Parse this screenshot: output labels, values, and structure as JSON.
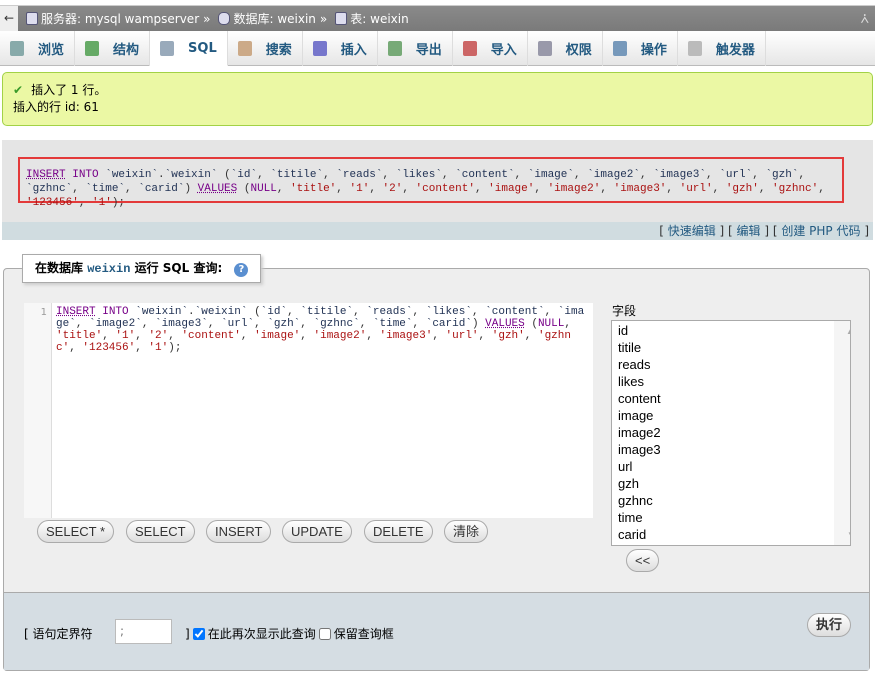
{
  "breadcrumb": {
    "back": "←",
    "server_label": "服务器: mysql wampserver",
    "database_label": "数据库: weixin",
    "table_label": "表: weixin",
    "separator": "»",
    "collapse": "⩑"
  },
  "tabs": [
    {
      "label": "浏览",
      "icon": "browse-icon",
      "color": "#8aa"
    },
    {
      "label": "结构",
      "icon": "structure-icon",
      "color": "#6a6"
    },
    {
      "label": "SQL",
      "icon": "sql-icon",
      "color": "#9ab",
      "active": true
    },
    {
      "label": "搜索",
      "icon": "search-icon",
      "color": "#ca8"
    },
    {
      "label": "插入",
      "icon": "insert-icon",
      "color": "#77c"
    },
    {
      "label": "导出",
      "icon": "export-icon",
      "color": "#7a7"
    },
    {
      "label": "导入",
      "icon": "import-icon",
      "color": "#c66"
    },
    {
      "label": "权限",
      "icon": "privileges-icon",
      "color": "#99a"
    },
    {
      "label": "操作",
      "icon": "wrench-icon",
      "color": "#79b"
    },
    {
      "label": "触发器",
      "icon": "triggers-icon",
      "color": "#bbb"
    }
  ],
  "message": {
    "line1": "插入了 1 行。",
    "line2": "插入的行 id: 61",
    "status_color": "#a2d246"
  },
  "executed_sql": "INSERT INTO `weixin`.`weixin` (`id`, `titile`, `reads`, `likes`, `content`, `image`, `image2`, `image3`, `url`, `gzh`, `gzhnc`, `time`, `carid`) VALUES (NULL, 'title', '1', '2', 'content', 'image', 'image2', 'image3', 'url', 'gzh', 'gzhnc', '123456', '1');",
  "sql_links": {
    "quick_edit": "快速编辑",
    "edit": "编辑",
    "create_php": "创建 PHP 代码"
  },
  "query_box": {
    "legend_prefix": "在数据库",
    "database": "weixin",
    "legend_suffix": "运行 SQL 查询:",
    "help": "?",
    "line_number": "1",
    "buttons": [
      "SELECT *",
      "SELECT",
      "INSERT",
      "UPDATE",
      "DELETE",
      "清除"
    ],
    "fields_label": "字段",
    "fields": [
      "id",
      "titile",
      "reads",
      "likes",
      "content",
      "image",
      "image2",
      "image3",
      "url",
      "gzh",
      "gzhnc",
      "time",
      "carid"
    ],
    "insert_field_button": "<<",
    "delimiter_label": "[ 语句定界符",
    "delimiter_value": ";",
    "bracket_close": "]",
    "show_again_label": "在此再次显示此查询",
    "show_again_checked": true,
    "retain_box_label": "保留查询框",
    "retain_box_checked": false,
    "go_button": "执行"
  }
}
